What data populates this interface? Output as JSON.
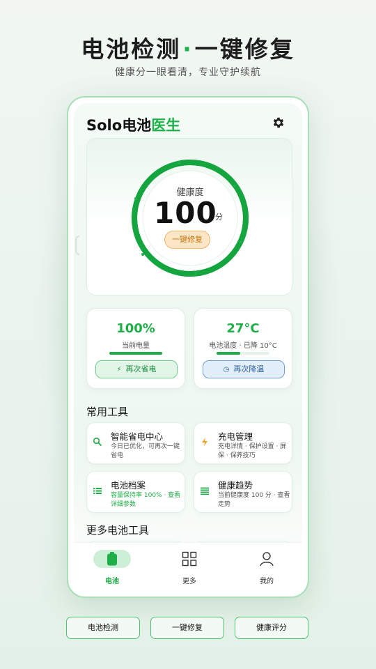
{
  "hero": {
    "title_part1": "电池检测",
    "title_dot": "·",
    "title_part2": "一键修复",
    "subtitle": "健康分一眼看清，专业守护续航"
  },
  "app": {
    "title_prefix": "Solo",
    "title_main": "电池",
    "title_accent": "医生",
    "settings_icon": "gear-icon"
  },
  "health": {
    "label": "健康度",
    "score": "100",
    "unit": "分",
    "score_fraction": 1.0,
    "repair_button": "一键修复"
  },
  "stats": {
    "battery": {
      "value": "100%",
      "caption": "当前电量",
      "level_fraction": 1.0,
      "button": "再次省电",
      "button_icon": "lightning-icon"
    },
    "temperature": {
      "value": "27°C",
      "caption": "电池温度 · 已降 10°C",
      "level_fraction": 0.45,
      "button": "再次降温",
      "button_icon": "clock-icon"
    }
  },
  "sections": {
    "common_tools": "常用工具",
    "more_tools": "更多电池工具"
  },
  "tools": [
    {
      "name": "智能省电中心",
      "desc": "今日已优化，可再次一键省电",
      "icon": "search-icon",
      "icon_color": "#1fae48",
      "highlight": false
    },
    {
      "name": "充电管理",
      "desc": "充电详情 · 保护设置 · 屏保 · 保养技巧",
      "icon": "lightning-icon",
      "icon_color": "#f0a224",
      "highlight": false
    },
    {
      "name": "电池档案",
      "desc": "容量保持率 100% · 查看详细参数",
      "icon": "list-icon",
      "icon_color": "#1fae48",
      "highlight": true
    },
    {
      "name": "健康趋势",
      "desc": "当前健康度 100 分 · 查看走势",
      "icon": "lines-icon",
      "icon_color": "#1fae48",
      "highlight": false
    }
  ],
  "tabs": [
    {
      "label": "电池",
      "icon": "battery-icon",
      "active": true
    },
    {
      "label": "更多",
      "icon": "grid-icon",
      "active": false
    },
    {
      "label": "我的",
      "icon": "user-icon",
      "active": false
    }
  ],
  "bottom_buttons": [
    "电池检测",
    "一键修复",
    "健康评分"
  ],
  "colors": {
    "accent": "#1fae48",
    "orange": "#f0a224",
    "blue": "#2b5e98"
  }
}
